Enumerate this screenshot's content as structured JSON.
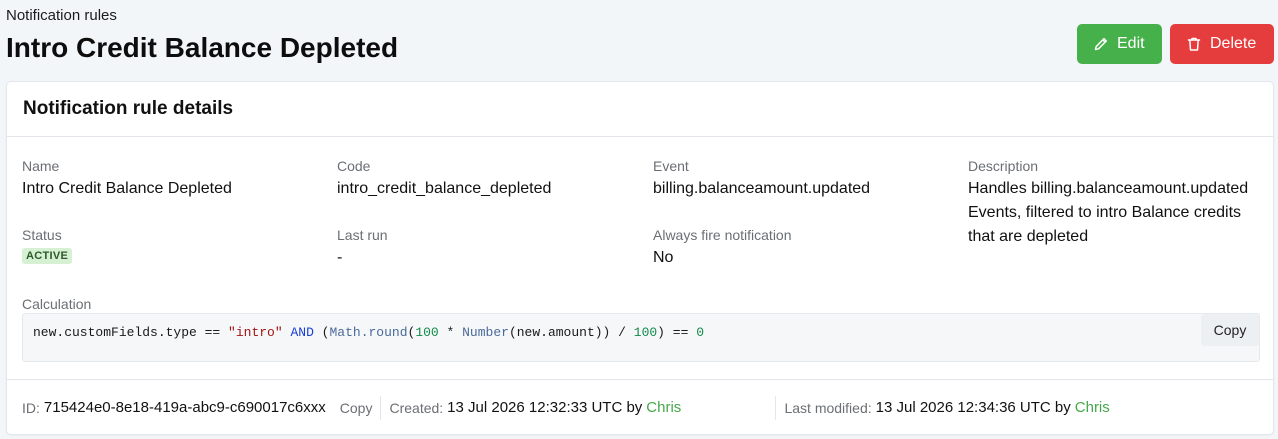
{
  "header": {
    "breadcrumb": "Notification rules",
    "title": "Intro Credit Balance Depleted",
    "edit_label": "Edit",
    "delete_label": "Delete"
  },
  "colors": {
    "edit": "#46b04a",
    "delete": "#e53d3d",
    "active_badge_bg": "#d6f0d3",
    "user_link": "#46a84a"
  },
  "details": {
    "card_title": "Notification rule details",
    "name": {
      "label": "Name",
      "value": "Intro Credit Balance Depleted"
    },
    "code": {
      "label": "Code",
      "value": "intro_credit_balance_depleted"
    },
    "event": {
      "label": "Event",
      "value": "billing.balanceamount.updated"
    },
    "description": {
      "label": "Description",
      "value": "Handles billing.balanceamount.updated Events, filtered to intro Balance credits that are depleted"
    },
    "status": {
      "label": "Status",
      "value": "ACTIVE"
    },
    "last_run": {
      "label": "Last run",
      "value": "-"
    },
    "always_fire": {
      "label": "Always fire notification",
      "value": "No"
    },
    "calculation": {
      "label": "Calculation",
      "tokens": {
        "t1": "new.customFields.type == ",
        "t2": "\"intro\"",
        "t3": " ",
        "t4": "AND",
        "t5": " (",
        "t6": "Math.round",
        "t7": "(",
        "t8": "100",
        "t9": " * ",
        "t10": "Number",
        "t11": "(new.amount)) / ",
        "t12": "100",
        "t13": ") == ",
        "t14": "0"
      },
      "copy_label": "Copy"
    }
  },
  "footer": {
    "id_label": "ID:",
    "id_value": "715424e0-8e18-419a-abc9-c690017c6xxx",
    "copy_label": "Copy",
    "created_label": "Created:",
    "created_value": "13 Jul 2026 12:32:33 UTC by",
    "created_by": "Chris",
    "modified_label": "Last modified:",
    "modified_value": "13 Jul 2026 12:34:36 UTC by",
    "modified_by": "Chris"
  },
  "icons": {
    "edit": "pencil-icon",
    "delete": "trash-icon"
  }
}
